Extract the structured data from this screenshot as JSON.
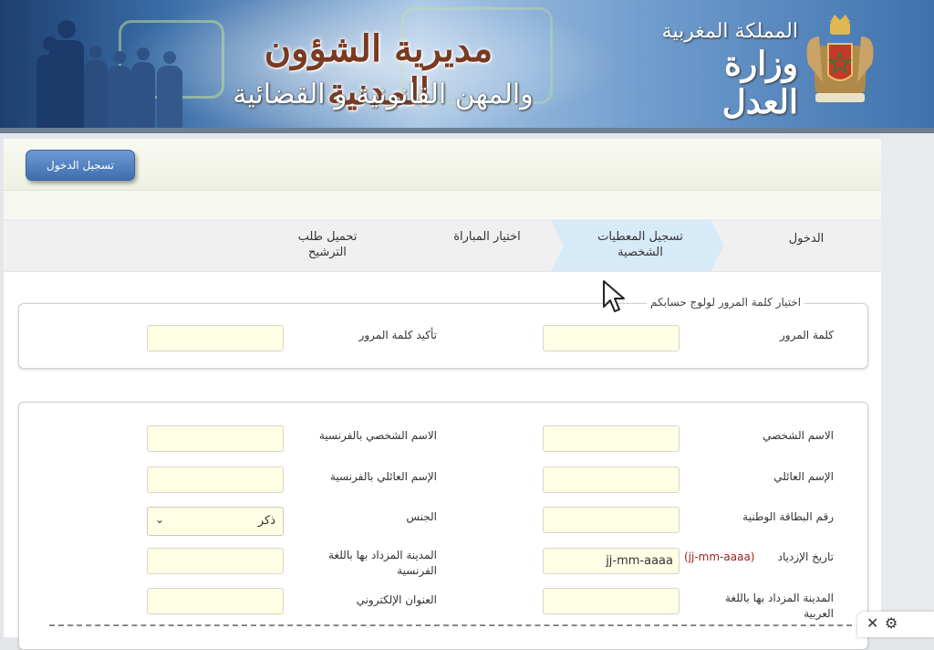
{
  "header": {
    "title_main": "مديرية الشؤون المدنية",
    "title_sub": "والمهن القانونية و القضائية",
    "kingdom": "المملكة المغربية",
    "ministry": "وزارة العدل"
  },
  "topbar": {
    "login_button": "تسجيل الدخول"
  },
  "steps": [
    {
      "label": "الدخول",
      "active": false
    },
    {
      "label": "تسجيل المعطيات الشخصية",
      "active": true
    },
    {
      "label": "اختيار المباراة",
      "active": false
    },
    {
      "label": "تحميل طلب الترشيح",
      "active": false
    }
  ],
  "password_section": {
    "legend": "اختيار كلمة المرور لولوج حسابكم",
    "password_label": "كلمة المرور",
    "password_value": "",
    "confirm_label": "تأكيد كلمة المرور",
    "confirm_value": ""
  },
  "personal_section": {
    "first_name_label": "الاسم الشخصي",
    "first_name_fr_label": "الاسم الشخصي بالفرنسية",
    "last_name_label": "الإسم العائلي",
    "last_name_fr_label": "الإسم العائلي بالفرنسية",
    "cin_label": "رقم البطاقة الوطنية",
    "gender_label": "الجنس",
    "gender_value": "ذكر",
    "birthdate_label": "تاريخ الإزدياد",
    "birthdate_hint": "(jj-mm-aaaa)",
    "birthdate_value": "jj-mm-aaaa",
    "birth_city_fr_label": "المدينة المزداد بها باللغة الفرنسية",
    "birth_city_ar_label": "المدينة المزداد بها باللغة العربية",
    "email_label": "العنوان الإلكتروني"
  },
  "tray": {
    "close_symbol": "✕",
    "gear_symbol": "⚙"
  },
  "colors": {
    "input_bg": "#ffffe6",
    "button_blue": "#4a78b8",
    "hint_red": "#a02020"
  }
}
